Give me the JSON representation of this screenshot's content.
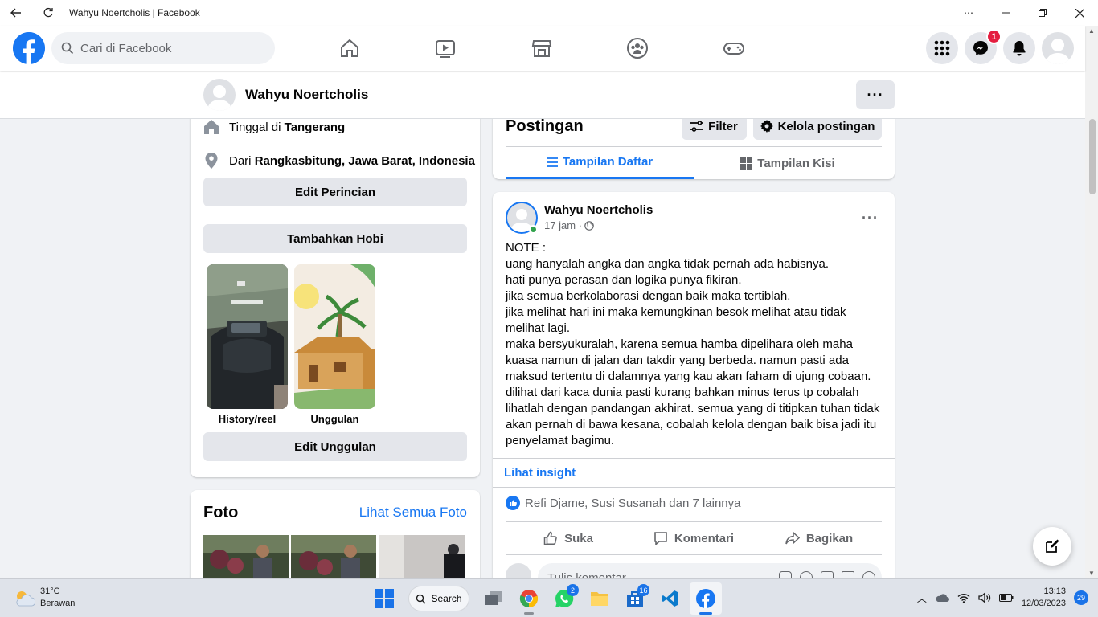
{
  "window": {
    "title": "Wahyu Noertcholis | Facebook"
  },
  "nav": {
    "search_placeholder": "Cari di Facebook",
    "messenger_badge": "1"
  },
  "profile_bar": {
    "name": "Wahyu Noertcholis"
  },
  "intro": {
    "lives_prefix": "Tinggal di ",
    "lives_city": "Tangerang",
    "from_prefix": "Dari ",
    "from_place": "Rangkasbitung, Jawa Barat, Indonesia",
    "edit_details": "Edit Perincian",
    "add_hobby": "Tambahkan Hobi",
    "featured": [
      {
        "label": "History/reel"
      },
      {
        "label": "Unggulan"
      }
    ],
    "edit_featured": "Edit Unggulan"
  },
  "photos": {
    "title": "Foto",
    "see_all": "Lihat Semua Foto"
  },
  "posts_header": {
    "title": "Postingan",
    "filter": "Filter",
    "manage": "Kelola postingan",
    "tab_list": "Tampilan Daftar",
    "tab_grid": "Tampilan Kisi"
  },
  "post": {
    "author": "Wahyu Noertcholis",
    "time": "17 jam ·",
    "body": "NOTE :\nuang hanyalah angka dan angka tidak pernah ada habisnya.\nhati punya perasan dan logika punya fikiran.\njika semua berkolaborasi dengan baik maka tertiblah.\njika melihat hari ini maka kemungkinan besok melihat atau tidak melihat lagi.\nmaka bersyukuralah, karena semua hamba dipelihara oleh maha kuasa namun di jalan dan takdir yang berbeda. namun pasti ada maksud tertentu di dalamnya yang kau akan faham di ujung cobaan.\n dilihat dari kaca dunia pasti kurang bahkan minus terus tp cobalah lihatlah dengan pandangan akhirat. semua yang di titipkan tuhan tidak akan pernah di bawa kesana, cobalah kelola dengan baik bisa jadi itu penyelamat bagimu.",
    "insight": "Lihat insight",
    "reactions": "Refi Djame, Susi Susanah dan 7 lainnya",
    "like": "Suka",
    "comment": "Komentari",
    "share": "Bagikan",
    "comment_placeholder": "Tulis komentar..."
  },
  "taskbar": {
    "temp": "31°C",
    "weather": "Berawan",
    "search": "Search",
    "whatsapp_badge": "2",
    "store_badge": "16",
    "time": "13:13",
    "date": "12/03/2023",
    "notif_count": "29"
  },
  "colors": {
    "brand": "#1877f2",
    "bg": "#f0f2f5"
  }
}
